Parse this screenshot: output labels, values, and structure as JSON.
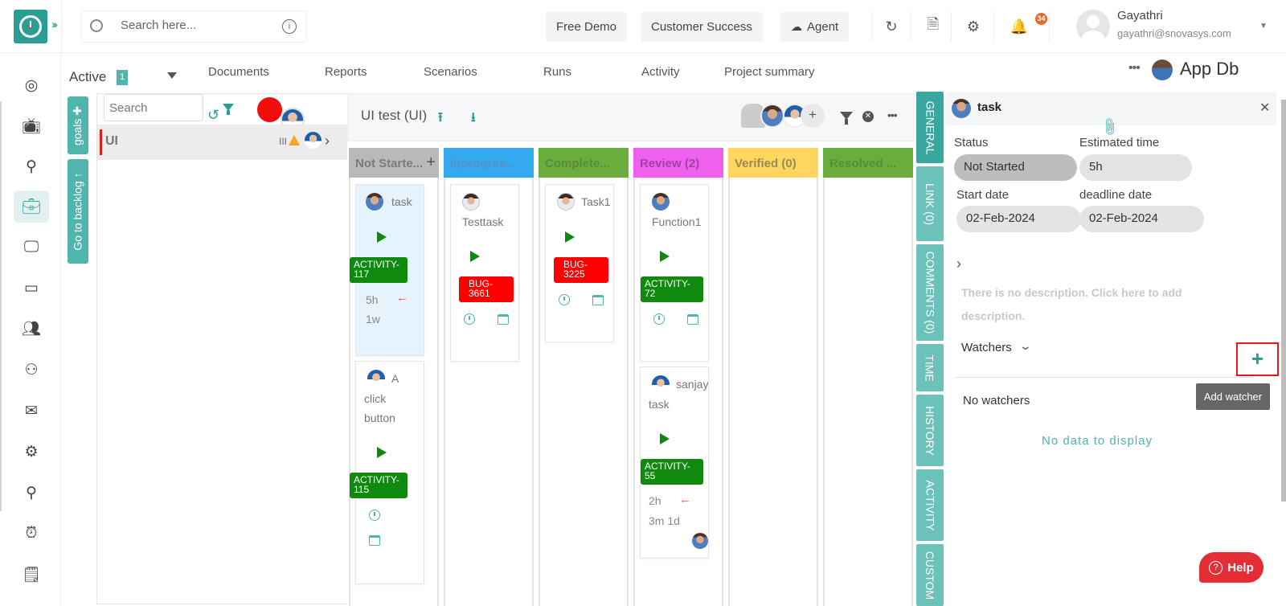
{
  "topbar": {
    "search_placeholder": "Search here...",
    "buttons": [
      "Free Demo",
      "Customer Success",
      "Agent"
    ],
    "notification_count": "34",
    "user_name": "Gayathri",
    "user_email": "gayathri@snovasys.com"
  },
  "sidebar": {
    "items": [
      {
        "icon": "target-icon"
      },
      {
        "icon": "tv-icon"
      },
      {
        "icon": "user-icon"
      },
      {
        "icon": "briefcase-icon",
        "active": true
      },
      {
        "icon": "monitor-icon"
      },
      {
        "icon": "credit-card-icon"
      },
      {
        "icon": "users-icon"
      },
      {
        "icon": "team-icon"
      },
      {
        "icon": "mail-icon"
      },
      {
        "icon": "settings-icon"
      },
      {
        "icon": "profile-icon"
      },
      {
        "icon": "alarm-icon"
      },
      {
        "icon": "invoice-icon"
      }
    ]
  },
  "subnav": {
    "active_label": "Active",
    "active_count": "1",
    "tabs": [
      "Documents",
      "Reports",
      "Scenarios",
      "Runs",
      "Activity",
      "Project summary"
    ],
    "project_name": "App Db"
  },
  "side_tabs": {
    "goals": "goals",
    "backlog": "Go to backlog"
  },
  "goals_panel": {
    "search_placeholder": "Search",
    "goal_name": "UI",
    "goal_meta": "III"
  },
  "board": {
    "title": "UI test (UI)",
    "columns": [
      {
        "label": "Not Starte...",
        "color": "#b9b9b9",
        "text_color": "#7a7a7a"
      },
      {
        "label": "Inprogres...",
        "color": "#33aaf0",
        "text_color": "#5a8fc8"
      },
      {
        "label": "Complete...",
        "color": "#6aad3d",
        "text_color": "#5a8a3a"
      },
      {
        "label": "Review (2)",
        "color": "#ef60ef",
        "text_color": "#a040a8"
      },
      {
        "label": "Verified (0)",
        "color": "#fdd65f",
        "text_color": "#9a8a55"
      },
      {
        "label": "Resolved ...",
        "color": "#6aad3d",
        "text_color": "#5a8a3a"
      }
    ],
    "cards": {
      "c1": {
        "title": "task",
        "tag": "ACTIVITY-117",
        "tag_line1": "ACTIVITY-",
        "tag_line2": "117",
        "estimate": "5h",
        "age": "1w"
      },
      "c2": {
        "title_line1": "A",
        "title_line2": "click",
        "title_line3": "button",
        "tag_line1": "ACTIVITY-",
        "tag_line2": "115"
      },
      "c3": {
        "title": "Testtask",
        "tag_line1": "BUG-",
        "tag_line2": "3661"
      },
      "c4": {
        "title": "Task1",
        "tag_line1": "BUG-",
        "tag_line2": "3225"
      },
      "c5": {
        "title": "Function1",
        "tag_line1": "ACTIVITY-",
        "tag_line2": "72"
      },
      "c6": {
        "title_line1": "sanjay",
        "title_line2": "task",
        "tag_line1": "ACTIVITY-",
        "tag_line2": "55",
        "estimate": "2h",
        "age": "3m 1d"
      }
    }
  },
  "detail_tabs": [
    "GENERAL",
    "LINK (0)",
    "COMMENTS (0)",
    "TIME",
    "HISTORY",
    "ACTIVITY",
    "CUSTOM"
  ],
  "detail": {
    "title": "task",
    "status_label": "Status",
    "status_value": "Not Started",
    "estimate_label": "Estimated time",
    "estimate_value": "5h",
    "start_label": "Start date",
    "start_value": "02-Feb-2024",
    "deadline_label": "deadline date",
    "deadline_value": "02-Feb-2024",
    "description": "There is no description. Click here to add description.",
    "watchers_label": "Watchers",
    "add_watcher_tooltip": "Add watcher",
    "no_watchers": "No watchers",
    "no_data": "No data to display"
  },
  "help_label": "Help"
}
